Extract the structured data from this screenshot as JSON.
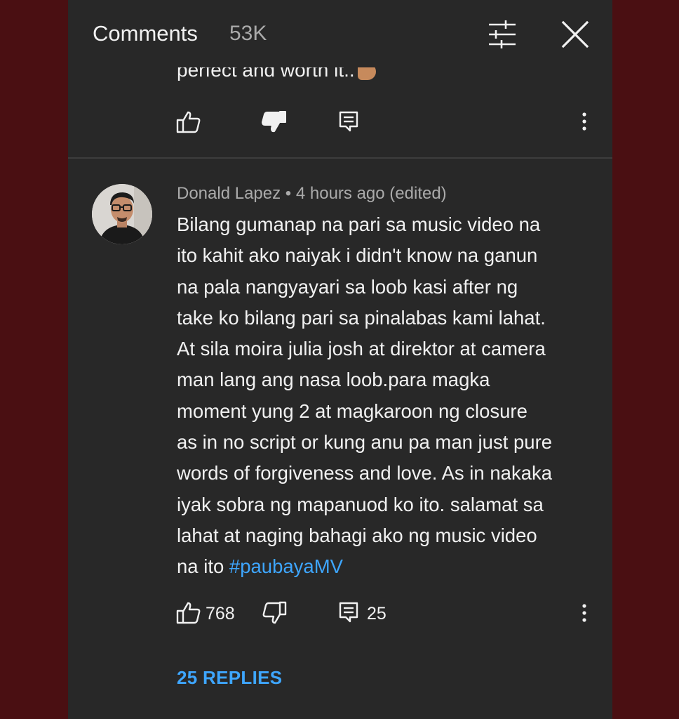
{
  "header": {
    "title": "Comments",
    "count": "53K"
  },
  "previous_comment": {
    "text_tail": "perfect and worth it.."
  },
  "comment": {
    "author": "Donald Lapez",
    "meta_suffix": " • 4 hours ago (edited)",
    "lines": [
      "Bilang gumanap na pari sa music video na",
      "ito kahit ako naiyak i didn't know na ganun",
      "na pala nangyayari sa loob kasi after ng",
      "take ko bilang pari sa pinalabas kami lahat.",
      "At sila moira julia josh at direktor at camera",
      "man lang ang nasa loob.para magka",
      "moment yung 2 at magkaroon ng closure",
      "as in no script or kung anu pa man just pure",
      "words of forgiveness and love. As in nakaka",
      "iyak sobra ng mapanuod ko ito. salamat sa",
      "lahat at naging bahagi ako ng music video",
      "na ito "
    ],
    "hashtag": "#paubayaMV",
    "likes": "768",
    "reply_count": "25",
    "replies_link": "25 REPLIES"
  },
  "colors": {
    "panel": "#282828",
    "backdrop": "#4a0f12",
    "link": "#3ea6ff",
    "secondary_text": "#aaaaaa"
  },
  "icons": [
    "filter-icon",
    "close-icon",
    "thumbs-up-icon",
    "thumbs-down-icon",
    "reply-icon",
    "more-vert-icon"
  ]
}
